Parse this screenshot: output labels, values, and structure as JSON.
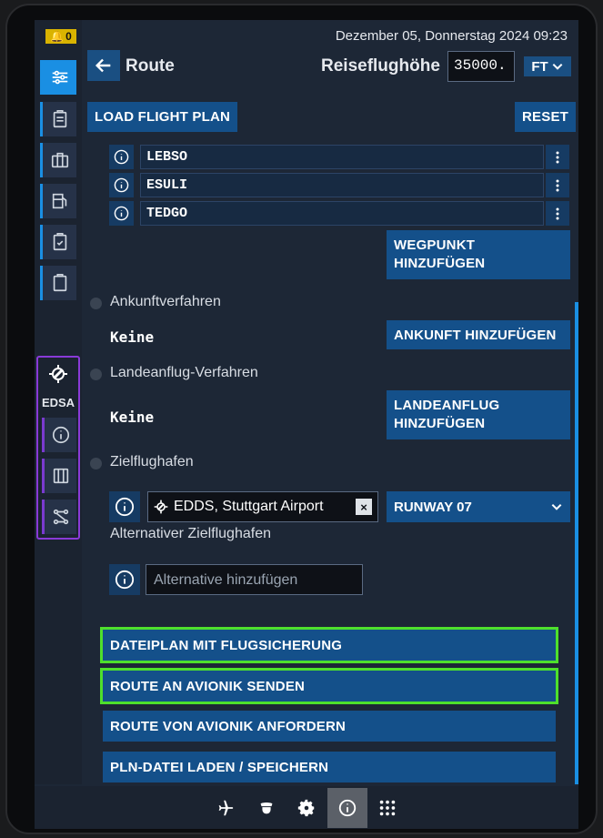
{
  "notifications": {
    "count": "0"
  },
  "header": {
    "datetime": "Dezember 05, Donnerstag 2024 09:23",
    "title": "Route",
    "altitude_label": "Reiseflughöhe",
    "altitude_value": "35000.",
    "unit": "FT"
  },
  "toolbar": {
    "load_label": "LOAD FLIGHT PLAN",
    "reset_label": "RESET"
  },
  "waypoints": [
    {
      "id": "LEBSO"
    },
    {
      "id": "ESULI"
    },
    {
      "id": "TEDGO"
    }
  ],
  "add_waypoint_label": "WEGPUNKT HINZUFÜGEN",
  "arrival": {
    "label": "Ankunftverfahren",
    "value": "Keine",
    "button": "ANKUNFT HINZUFÜGEN"
  },
  "approach": {
    "label": "Landeanflug-Verfahren",
    "value": "Keine",
    "button": "LANDEANFLUG HINZUFÜGEN"
  },
  "destination": {
    "label": "Zielflughafen",
    "airport": "EDDS, Stuttgart Airport",
    "runway": "RUNWAY 07"
  },
  "alternate": {
    "label": "Alternativer Zielflughafen",
    "placeholder": "Alternative hinzufügen"
  },
  "actions": {
    "file_plan": "DATEIPLAN MIT FLUGSICHERUNG",
    "send_route": "ROUTE AN AVIONIK SENDEN",
    "request_route": "ROUTE VON AVIONIK ANFORDERN",
    "pln_file": "PLN-DATEI LADEN / SPEICHERN"
  },
  "sidebar_group": {
    "airport": "EDSA"
  },
  "colors": {
    "accent": "#1a8fe3",
    "button": "#14508a",
    "highlight": "#4ee02c",
    "group_border": "#8a3ad8"
  }
}
